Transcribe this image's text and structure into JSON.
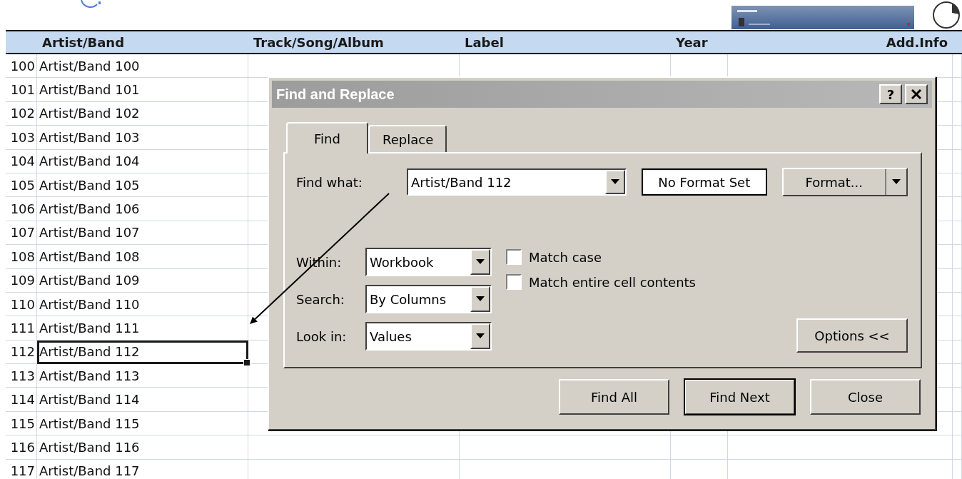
{
  "spreadsheet": {
    "columns": [
      {
        "label": "Artist/Band"
      },
      {
        "label": "Track/Song/Album"
      },
      {
        "label": "Label"
      },
      {
        "label": "Year"
      },
      {
        "label": "Add.Info"
      }
    ],
    "rows": [
      {
        "number": "100",
        "artist": "Artist/Band 100",
        "selected": false
      },
      {
        "number": "101",
        "artist": "Artist/Band 101",
        "selected": false
      },
      {
        "number": "102",
        "artist": "Artist/Band 102",
        "selected": false
      },
      {
        "number": "103",
        "artist": "Artist/Band 103",
        "selected": false
      },
      {
        "number": "104",
        "artist": "Artist/Band 104",
        "selected": false
      },
      {
        "number": "105",
        "artist": "Artist/Band 105",
        "selected": false
      },
      {
        "number": "106",
        "artist": "Artist/Band 106",
        "selected": false
      },
      {
        "number": "107",
        "artist": "Artist/Band 107",
        "selected": false
      },
      {
        "number": "108",
        "artist": "Artist/Band 108",
        "selected": false
      },
      {
        "number": "109",
        "artist": "Artist/Band 109",
        "selected": false
      },
      {
        "number": "110",
        "artist": "Artist/Band 110",
        "selected": false
      },
      {
        "number": "111",
        "artist": "Artist/Band 111",
        "selected": false
      },
      {
        "number": "112",
        "artist": "Artist/Band 112",
        "selected": true
      },
      {
        "number": "113",
        "artist": "Artist/Band 113",
        "selected": false
      },
      {
        "number": "114",
        "artist": "Artist/Band 114",
        "selected": false
      },
      {
        "number": "115",
        "artist": "Artist/Band 115",
        "selected": false
      },
      {
        "number": "116",
        "artist": "Artist/Band 116",
        "selected": false
      },
      {
        "number": "117",
        "artist": "Artist/Band 117",
        "selected": false
      }
    ]
  },
  "dialog": {
    "title": "Find and Replace",
    "help_button": "?",
    "tabs": [
      {
        "label": "Find",
        "selected": true
      },
      {
        "label": "Replace",
        "selected": false
      }
    ],
    "find_what": {
      "label": "Find what:",
      "value": "Artist/Band 112"
    },
    "format_status": "No Format Set",
    "format_button": "Format...",
    "options": [
      {
        "label": "Within:",
        "value": "Workbook"
      },
      {
        "label": "Search:",
        "value": "By Columns"
      },
      {
        "label": "Look in:",
        "value": "Values"
      }
    ],
    "checkboxes": [
      {
        "label": "Match case",
        "checked": false
      },
      {
        "label": "Match entire cell contents",
        "checked": false
      }
    ],
    "options_button": "Options <<",
    "buttons": [
      {
        "label": "Find All",
        "default": false
      },
      {
        "label": "Find Next",
        "default": true
      },
      {
        "label": "Close",
        "default": false
      }
    ]
  }
}
